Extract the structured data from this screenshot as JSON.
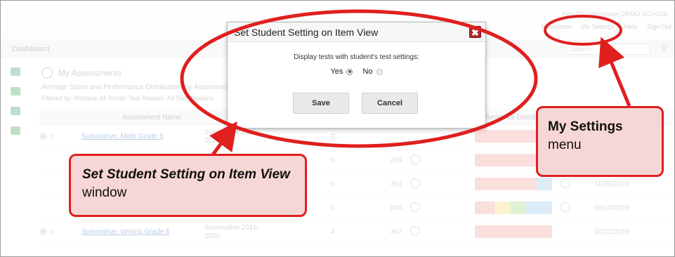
{
  "header": {
    "user_text": "Alex TC | Hometown DEMO SCHOOL",
    "links": {
      "resources": "Resources",
      "settings": "My Settings",
      "help": "Help",
      "signout": "Sign Out"
    }
  },
  "dashboard": {
    "title": "Dashboard",
    "search_placeholder": "Search"
  },
  "card": {
    "title": "My Assessments",
    "subtitle": "Average Score and Performance Distribution, by Assessment",
    "filter": "Filtered by: Rosters: All Roster   Test Reason: All Test Reasons"
  },
  "table": {
    "header_name": "Assessment Name",
    "header_performance": "Performance Distribution",
    "rows": [
      {
        "name": "Summative, Math Grade 6",
        "type": "Summative 2019-2020",
        "num": "2",
        "count": "",
        "date": ""
      },
      {
        "name": "",
        "type": "",
        "num": "5",
        "count": "269",
        "date": ""
      },
      {
        "name": "",
        "type": "",
        "num": "6",
        "count": "361",
        "date": "11/26/2019"
      },
      {
        "name": "",
        "type": "",
        "num": "5",
        "count": "845",
        "date": "09/10/2019"
      },
      {
        "name": "Summative, Writing Grade 6",
        "type": "Summative 2019-2020",
        "num": "4",
        "count": "367",
        "date": "10/22/2019"
      }
    ]
  },
  "modal": {
    "title": "Set Student Setting on Item View",
    "close_symbol": "✖",
    "question": "Display tests with student's test settings:",
    "yes_label": "Yes",
    "no_label": "No",
    "selected": "Yes",
    "save_label": "Save",
    "cancel_label": "Cancel"
  },
  "annotations": {
    "left_italic": "Set Student Setting on Item View",
    "left_rest": " window",
    "right_bold": "My Settings",
    "right_rest": "menu"
  },
  "colors": {
    "annotation_red": "#e01f1f",
    "callout_fill": "#f7d7d5",
    "close_red": "#b0262b",
    "link_blue": "#3a6fb0"
  }
}
